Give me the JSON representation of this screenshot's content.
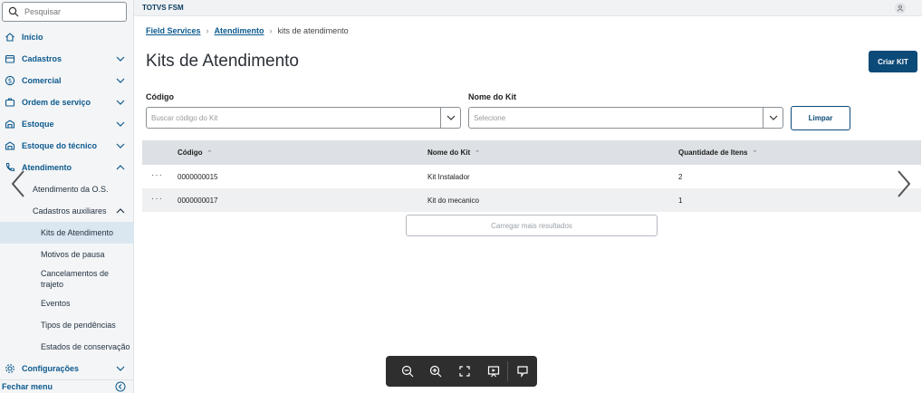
{
  "sidebar": {
    "search_placeholder": "Pesquisar",
    "items": [
      {
        "label": "Início"
      },
      {
        "label": "Cadastros"
      },
      {
        "label": "Comercial"
      },
      {
        "label": "Ordem de serviço"
      },
      {
        "label": "Estoque"
      },
      {
        "label": "Estoque do técnico"
      },
      {
        "label": "Atendimento"
      }
    ],
    "subitems": {
      "atendimento_os": "Atendimento da O.S.",
      "cadastros_auxiliares": "Cadastros auxiliares",
      "kits": "Kits de Atendimento",
      "motivos": "Motivos de pausa",
      "cancelamentos": "Cancelamentos de trajeto",
      "eventos": "Eventos",
      "tipos": "Tipos de pendências",
      "estados": "Estados de conservação"
    },
    "config": "Configurações",
    "footer": "Fechar menu"
  },
  "topbar": {
    "app_name": "TOTVS FSM"
  },
  "breadcrumb": {
    "root": "Field Services",
    "parent": "Atendimento",
    "current": "kits de atendimento"
  },
  "page": {
    "title": "Kits de Atendimento",
    "create_button": "Criar KIT"
  },
  "filters": {
    "code_label": "Código",
    "code_placeholder": "Buscar código do Kit",
    "name_label": "Nome do Kit",
    "name_placeholder": "Selecione",
    "clear_button": "Limpar"
  },
  "table": {
    "headers": [
      "Código",
      "Nome do Kit",
      "Quantidade de Itens"
    ],
    "rows": [
      {
        "code": "0000000015",
        "name": "Kit Instalador",
        "qty": "2"
      },
      {
        "code": "0000000017",
        "name": "Kit do mecanico",
        "qty": "1"
      }
    ],
    "load_more": "Carregar mais resultados",
    "row_menu": "···",
    "sort_glyph": "⌃"
  },
  "colors": {
    "primary": "#0c4a78",
    "link": "#0c5a8f",
    "active_bg": "#dbe7f0"
  }
}
